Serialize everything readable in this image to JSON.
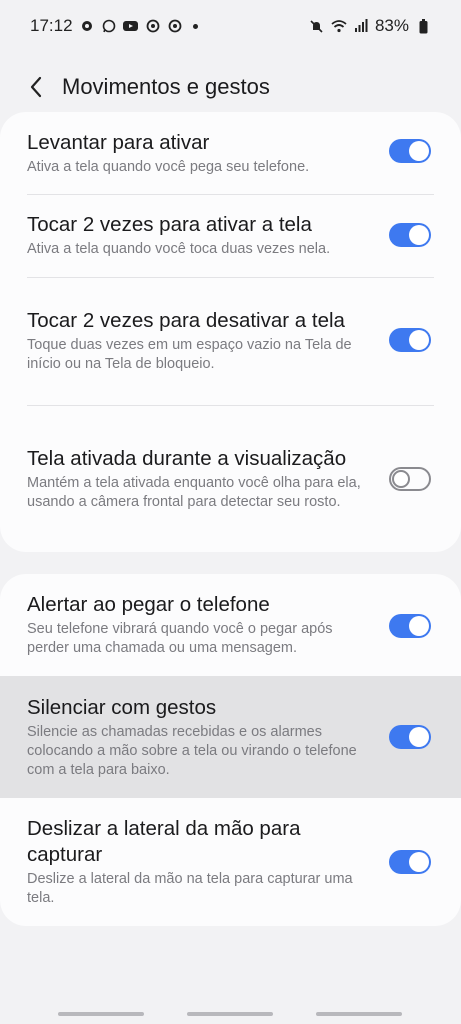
{
  "status": {
    "time": "17:12",
    "battery": "83%"
  },
  "header": {
    "title": "Movimentos e gestos"
  },
  "colors": {
    "accent": "#3e79f0",
    "background": "#f2f2f4",
    "card": "#fcfcfd"
  },
  "settings": [
    {
      "title": "Levantar para ativar",
      "subtitle": "Ativa a tela quando você pega seu telefone.",
      "enabled": true
    },
    {
      "title": "Tocar 2 vezes para ativar a tela",
      "subtitle": "Ativa a tela quando você toca duas vezes nela.",
      "enabled": true
    },
    {
      "title": "Tocar 2 vezes para desativar a tela",
      "subtitle": "Toque duas vezes em um espaço vazio na Tela de início ou na Tela de bloqueio.",
      "enabled": true
    },
    {
      "title": "Tela ativada durante a visualização",
      "subtitle": "Mantém a tela ativada enquanto você olha para ela, usando a câmera frontal para detectar seu rosto.",
      "enabled": false
    },
    {
      "title": "Alertar ao pegar o telefone",
      "subtitle": "Seu telefone vibrará quando você o pegar após perder uma chamada ou uma mensagem.",
      "enabled": true
    },
    {
      "title": "Silenciar com gestos",
      "subtitle": "Silencie as chamadas recebidas e os alarmes colocando a mão sobre a tela ou virando o telefone com a tela para baixo.",
      "enabled": true
    },
    {
      "title": "Deslizar a lateral da mão para capturar",
      "subtitle": "Deslize a lateral da mão na tela para capturar uma tela.",
      "enabled": true
    }
  ]
}
